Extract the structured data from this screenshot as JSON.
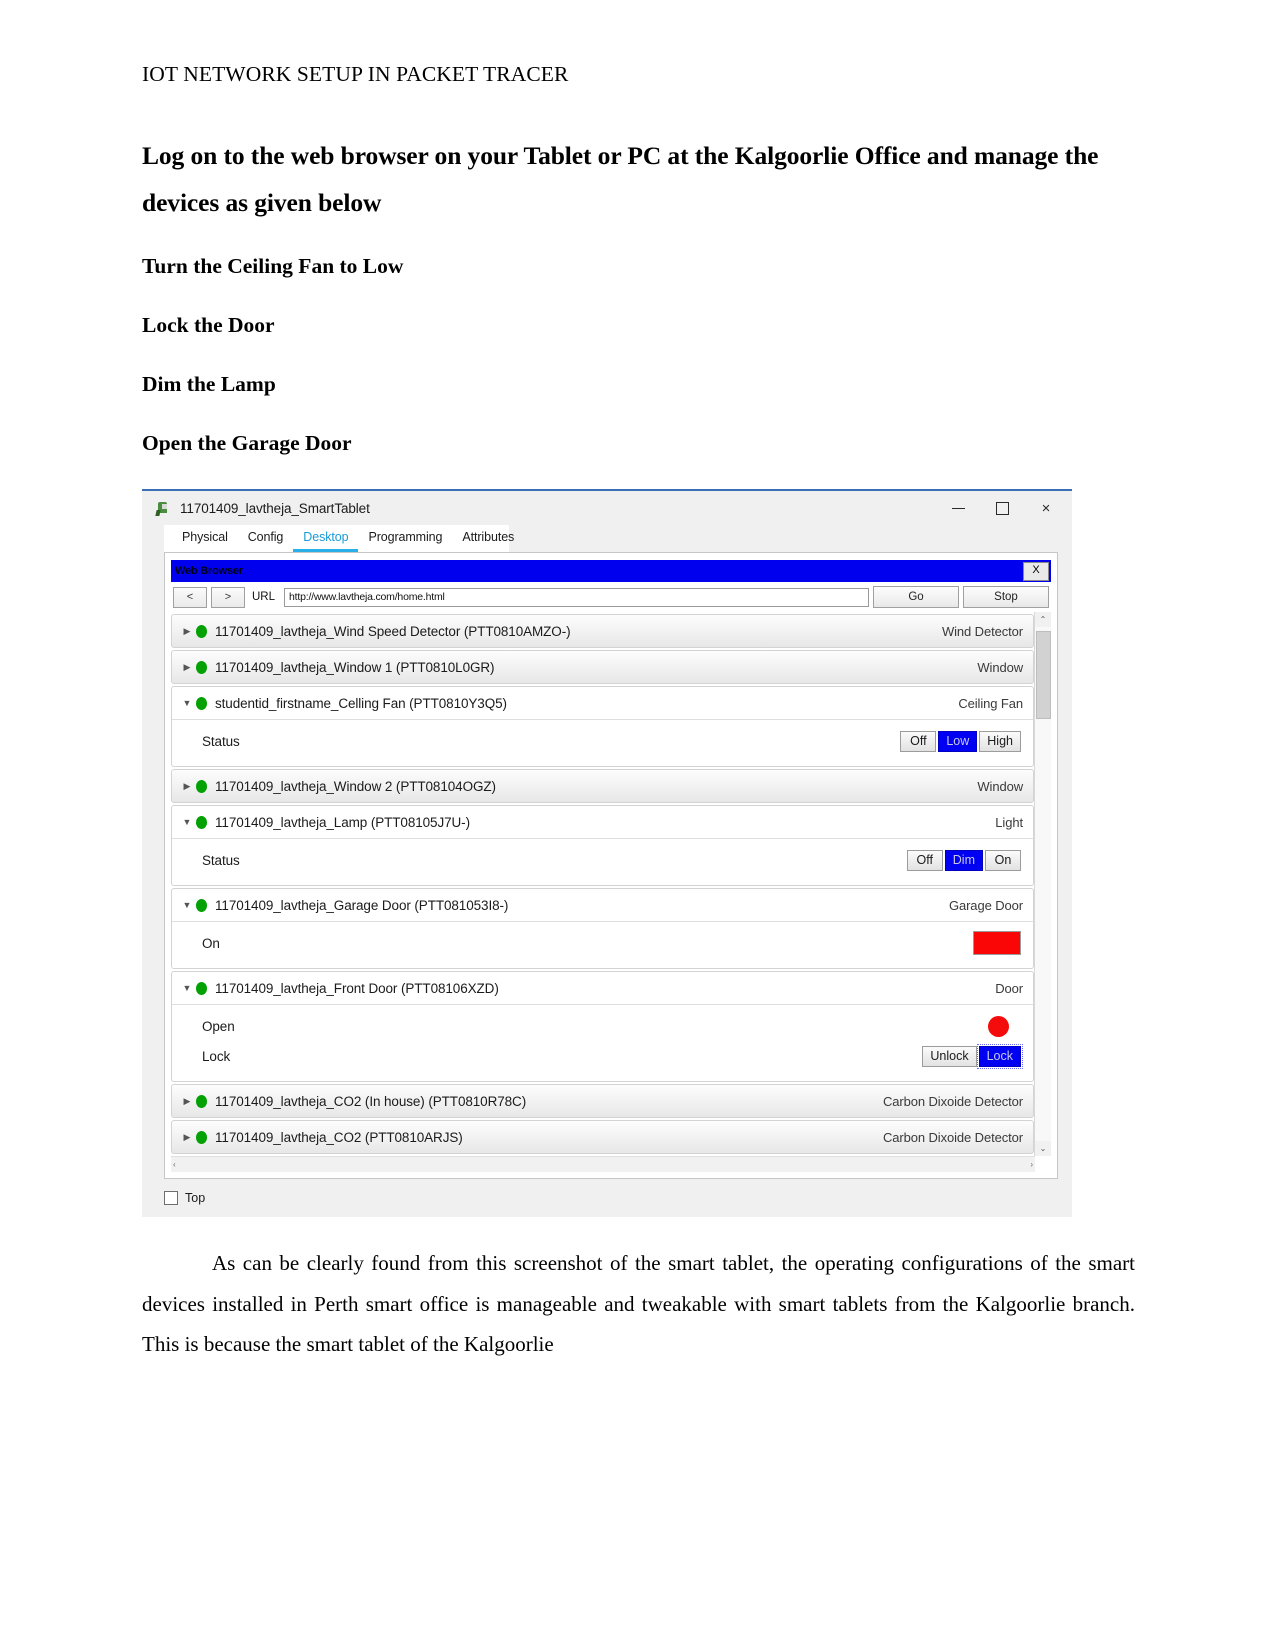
{
  "document": {
    "header": "IOT NETWORK SETUP IN PACKET TRACER",
    "heading_main": "Log on to the web browser on your Tablet or PC at the Kalgoorlie Office and manage the devices as given below",
    "tasks": [
      "Turn the Ceiling Fan to Low",
      "Lock the Door",
      "Dim the Lamp",
      "Open the Garage Door"
    ],
    "paragraph": "As can be clearly found from this screenshot of the smart tablet, the operating configurations of the smart devices installed in Perth smart office is manageable and tweakable with smart tablets from the Kalgoorlie branch. This is because the smart tablet of the Kalgoorlie"
  },
  "screenshot": {
    "window": {
      "title": "11701409_lavtheja_SmartTablet",
      "minimize": "–",
      "maximize": "☐",
      "close": "×"
    },
    "tabs": [
      {
        "label": "Physical",
        "active": false
      },
      {
        "label": "Config",
        "active": false
      },
      {
        "label": "Desktop",
        "active": true
      },
      {
        "label": "Programming",
        "active": false
      },
      {
        "label": "Attributes",
        "active": false
      }
    ],
    "browser": {
      "title": "Web Browser",
      "close_label": "X",
      "back_label": "<",
      "forward_label": ">",
      "url_label": "URL",
      "url_value": "http://www.lavtheja.com/home.html",
      "go_label": "Go",
      "stop_label": "Stop"
    },
    "devices": [
      {
        "name": "11701409_lavtheja_Wind Speed Detector (PTT0810AMZO-)",
        "type": "Wind Detector",
        "expanded": false,
        "status": "online",
        "controls": []
      },
      {
        "name": "11701409_lavtheja_Window 1 (PTT0810L0GR)",
        "type": "Window",
        "expanded": false,
        "status": "online",
        "controls": []
      },
      {
        "name": "studentid_firstname_Celling Fan (PTT0810Y3Q5)",
        "type": "Ceiling Fan",
        "expanded": true,
        "status": "online",
        "controls": [
          {
            "label": "Status",
            "kind": "segmented",
            "options": [
              "Off",
              "Low",
              "High"
            ],
            "selected": "Low",
            "focused": false
          }
        ]
      },
      {
        "name": "11701409_lavtheja_Window 2 (PTT08104OGZ)",
        "type": "Window",
        "expanded": false,
        "status": "online",
        "controls": []
      },
      {
        "name": "11701409_lavtheja_Lamp (PTT08105J7U-)",
        "type": "Light",
        "expanded": true,
        "status": "online",
        "controls": [
          {
            "label": "Status",
            "kind": "segmented",
            "options": [
              "Off",
              "Dim",
              "On"
            ],
            "selected": "Dim",
            "focused": false
          }
        ]
      },
      {
        "name": "11701409_lavtheja_Garage Door (PTT081053I8-)",
        "type": "Garage Door",
        "expanded": true,
        "status": "online",
        "controls": [
          {
            "label": "On",
            "kind": "swatch",
            "color": "#fb0606"
          }
        ]
      },
      {
        "name": "11701409_lavtheja_Front Door (PTT08106XZD)",
        "type": "Door",
        "expanded": true,
        "status": "online",
        "controls": [
          {
            "label": "Open",
            "kind": "indicator",
            "color": "#f40b0b"
          },
          {
            "label": "Lock",
            "kind": "segmented",
            "options": [
              "Unlock",
              "Lock"
            ],
            "selected": "Lock",
            "focused": true
          }
        ]
      },
      {
        "name": "11701409_lavtheja_CO2 (In house) (PTT0810R78C)",
        "type": "Carbon Dixoide Detector",
        "expanded": false,
        "status": "online",
        "controls": []
      },
      {
        "name": "11701409_lavtheja_CO2 (PTT0810ARJS)",
        "type": "Carbon Dixoide Detector",
        "expanded": false,
        "status": "online",
        "controls": []
      }
    ],
    "scroll": {
      "up_arrow": "⌃",
      "down_arrow": "⌄",
      "left_arrow": "‹",
      "right_arrow": "›"
    },
    "footer": {
      "checkbox_label": "Top",
      "checked": false
    }
  },
  "colors": {
    "accent_blue": "#29b0e8",
    "selected_blue": "#0000f2",
    "browser_title_blue": "#0000ee",
    "led_green": "#04a104",
    "alert_red": "#fb0606"
  }
}
